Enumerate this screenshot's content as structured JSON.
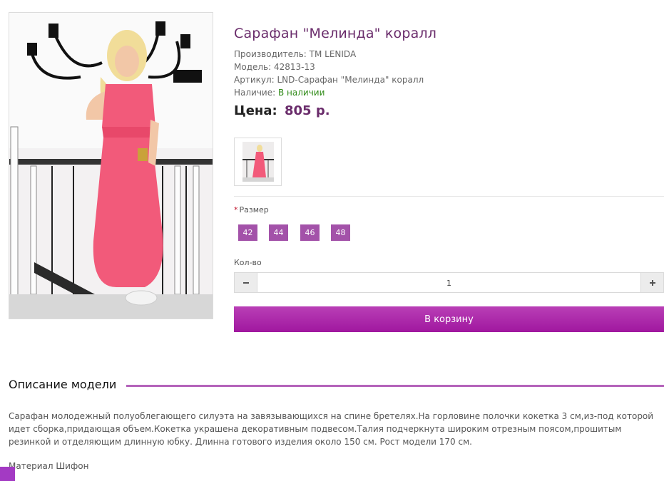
{
  "product": {
    "title": "Сарафан \"Мелинда\" коралл",
    "manufacturer_line": "Производитель: TM LENIDA",
    "model_line": "Модель: 42813-13",
    "sku_line": "Артикул: LND-Сарафан \"Мелинда\" коралл",
    "availability_label": "Наличие: ",
    "availability_value": "В наличии",
    "price_label": "Цена:",
    "price_value": "805 р."
  },
  "options": {
    "size_label": "Размер",
    "required_mark": "*",
    "sizes": [
      "42",
      "44",
      "46",
      "48"
    ],
    "qty_label": "Кол-во",
    "qty_value": "1",
    "minus_icon": "minus-icon",
    "plus_icon": "plus-icon"
  },
  "cart": {
    "button_label": "В корзину"
  },
  "description": {
    "heading": "Описание модели",
    "text": "Сарафан молодежный полуоблегающего силуэта на завязывающихся на спине бретелях.На горловине полочки кокетка 3 см,из-под которой идет сборка,придающая объем.Кокетка украшена декоративным подвесом.Талия подчеркнута широким отрезным поясом,прошитым резинкой и отделяющим длинную юбку. Длинна готового изделия около 150 см. Рост модели 170 см.",
    "material": "Материал Шифон"
  },
  "colors": {
    "title": "#6a2c6b",
    "accent": "#a352a9",
    "cart_button": "#a0179f",
    "in_stock": "#2f8a17",
    "dress": "#f25a7a"
  }
}
